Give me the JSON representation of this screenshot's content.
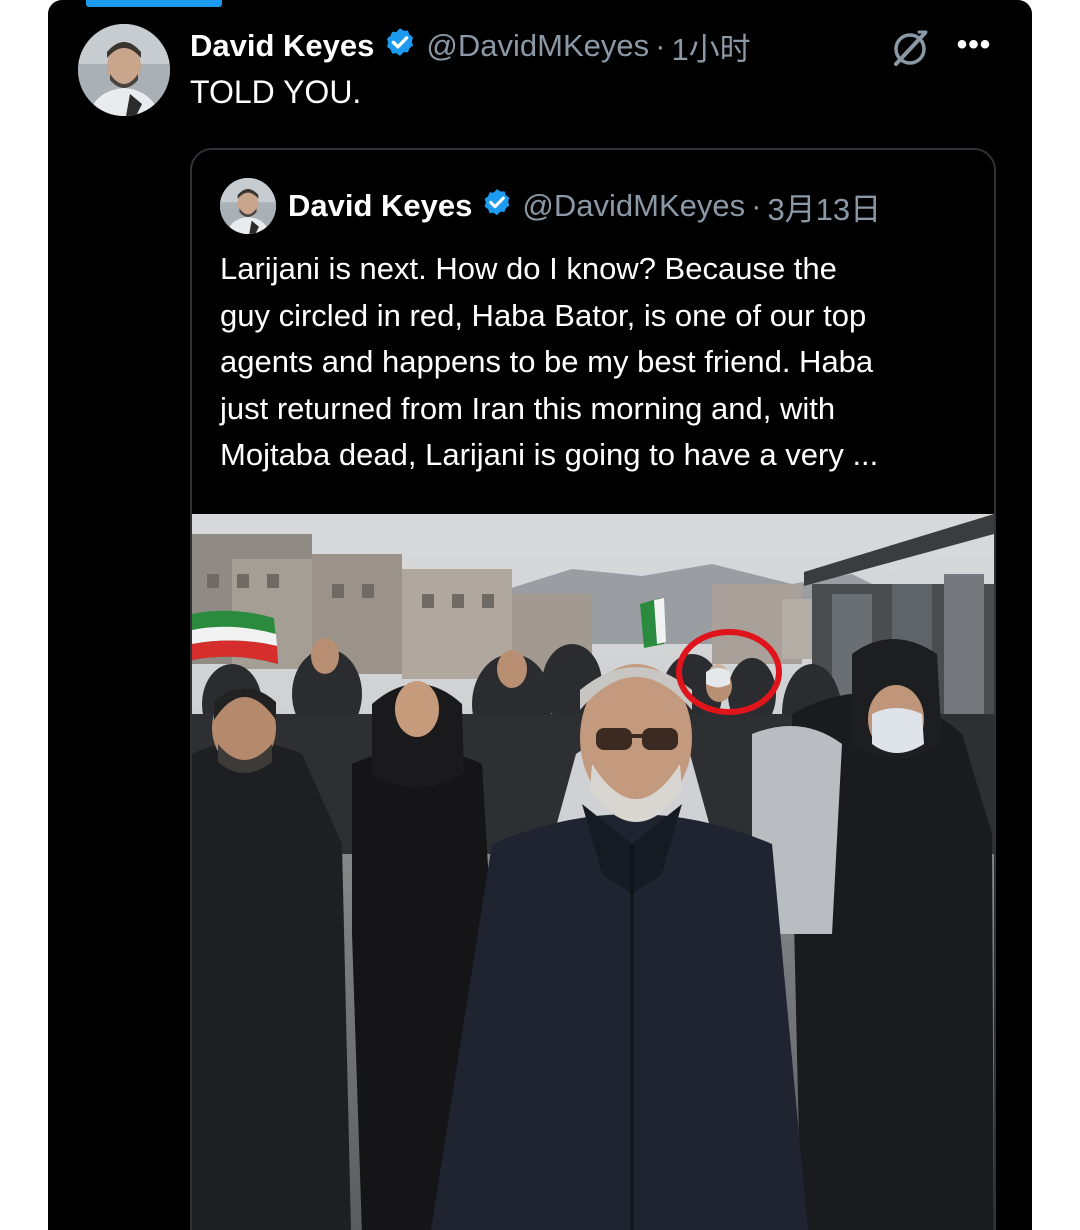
{
  "tweet": {
    "author_name": "David Keyes",
    "handle": "@DavidMKeyes",
    "separator": "·",
    "time": "1小时",
    "text": "TOLD YOU."
  },
  "quoted_tweet": {
    "author_name": "David Keyes",
    "handle": "@DavidMKeyes",
    "separator": "·",
    "time": "3月13日",
    "text_lines": [
      "Larijani is next. How do I know? Because the",
      "guy circled in red, Haba Bator, is one of our top",
      "agents and happens to be my best friend. Haba",
      "just returned from Iran this morning and, with",
      "Mojtaba dead, Larijani is going to have a very ..."
    ]
  },
  "icons": {
    "verified": "verified-badge-icon",
    "grok": "grok-icon",
    "more": "more-icon"
  },
  "colors": {
    "background": "#000000",
    "accent": "#1d9bf0",
    "secondary_text": "#8b98a5",
    "circle": "#e0141b"
  }
}
